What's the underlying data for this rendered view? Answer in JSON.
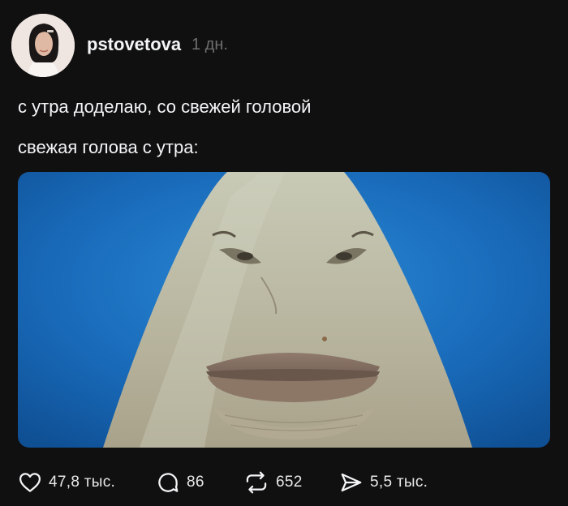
{
  "post": {
    "author": {
      "username": "pstovetova"
    },
    "timestamp": "1 дн.",
    "text_lines": [
      "с утра доделаю, со свежей головой",
      "свежая голова с утра:"
    ],
    "media": {
      "icon": "photo-shark-face"
    }
  },
  "actions": {
    "likes": {
      "count": "47,8 тыс.",
      "icon": "heart-icon"
    },
    "replies": {
      "count": "86",
      "icon": "comment-icon"
    },
    "reposts": {
      "count": "652",
      "icon": "repost-icon"
    },
    "shares": {
      "count": "5,5 тыс.",
      "icon": "send-icon"
    }
  },
  "colors": {
    "background": "#101010",
    "text": "#f3f5f7",
    "muted": "#6f6f6f",
    "ocean": "#1a6fc0"
  }
}
